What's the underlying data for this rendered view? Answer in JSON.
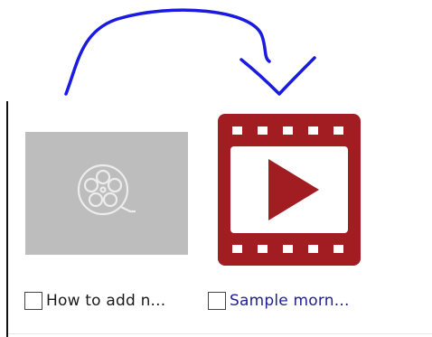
{
  "items": [
    {
      "caption": "How to add n...",
      "selected": false,
      "thumbnail": "film-reel-placeholder-icon"
    },
    {
      "caption": "Sample morn...",
      "selected": false,
      "thumbnail": "video-play-icon"
    }
  ],
  "colors": {
    "video_icon_red": "#a11d22",
    "placeholder_gray": "#bdbdbd",
    "annotation_arrow": "#1a1ae0"
  }
}
